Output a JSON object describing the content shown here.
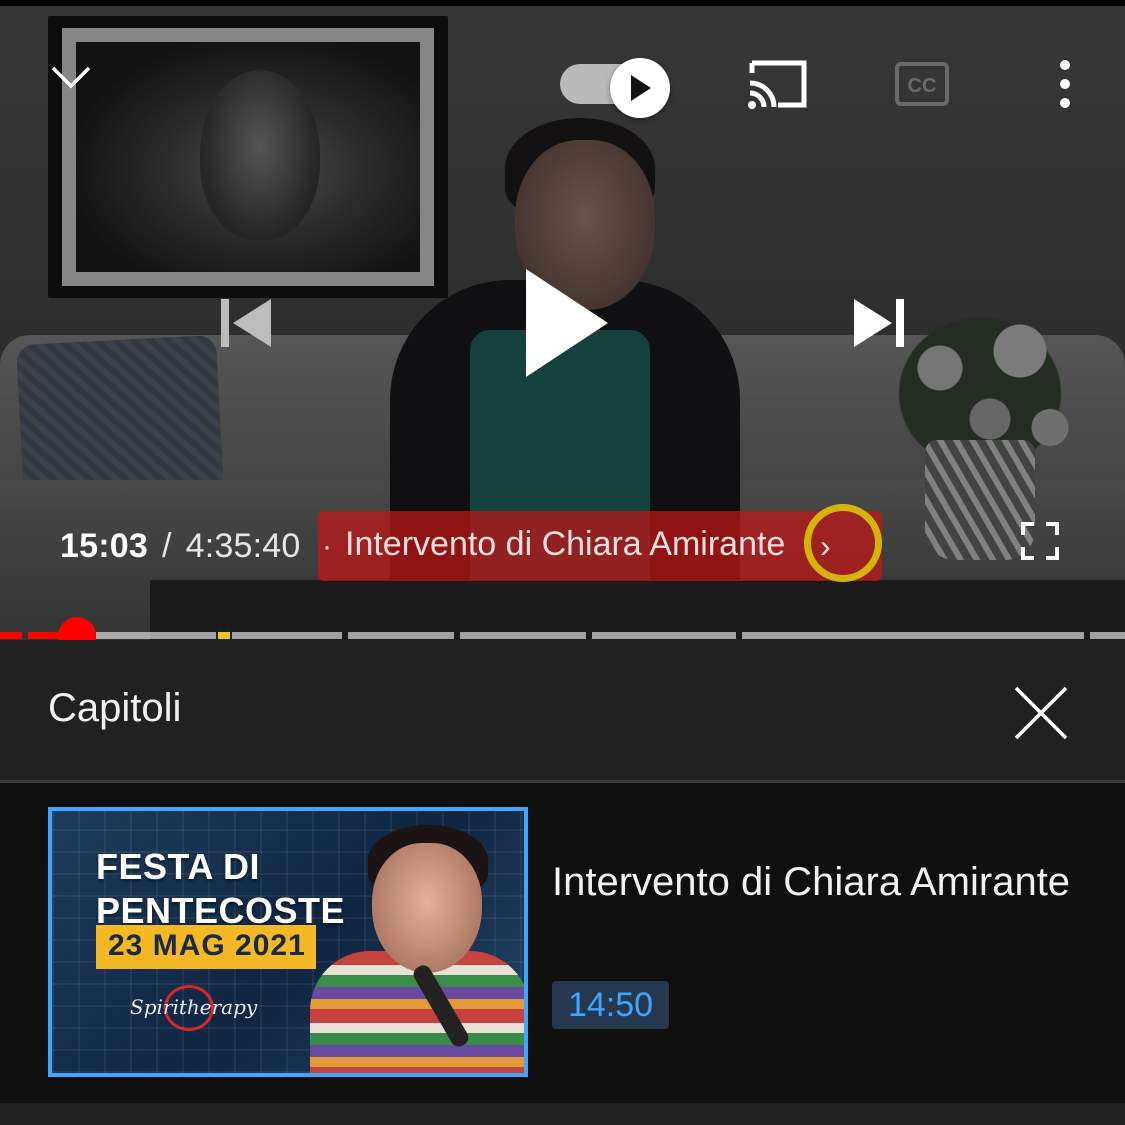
{
  "player": {
    "time_current": "15:03",
    "time_separator": "/",
    "time_total": "4:35:40",
    "chapter_separator": "·",
    "chapter_title": "Intervento di Chiara Amirante",
    "chapter_chevron": "›",
    "autoplay_on": true,
    "progress_fraction": 0.054,
    "icons": {
      "collapse": "chevron-down-icon",
      "autoplay": "autoplay-toggle-icon",
      "cast": "cast-icon",
      "captions": "closed-captions-icon",
      "more": "more-vert-icon",
      "previous": "skip-previous-icon",
      "play": "play-icon",
      "next": "skip-next-icon",
      "fullscreen": "fullscreen-icon"
    },
    "colors": {
      "progress_played": "#ff0000",
      "chapter_pill": "#c41616",
      "highlight_ring": "#d4b40b",
      "chapter_marker": "#f2c417"
    }
  },
  "chapters_panel": {
    "title": "Capitoli",
    "close_icon": "close-icon",
    "items": [
      {
        "title": "Intervento di Chiara Amirante",
        "timestamp": "14:50",
        "selected": true,
        "thumbnail": {
          "title_line1": "FESTA DI",
          "title_line2": "PENTECOSTE",
          "date": "23 MAG 2021",
          "logo_text": "Spiritherapy"
        }
      }
    ],
    "colors": {
      "selected_border": "#3ea6ff",
      "timestamp_text": "#3ea6ff",
      "timestamp_bg": "#263850"
    }
  }
}
